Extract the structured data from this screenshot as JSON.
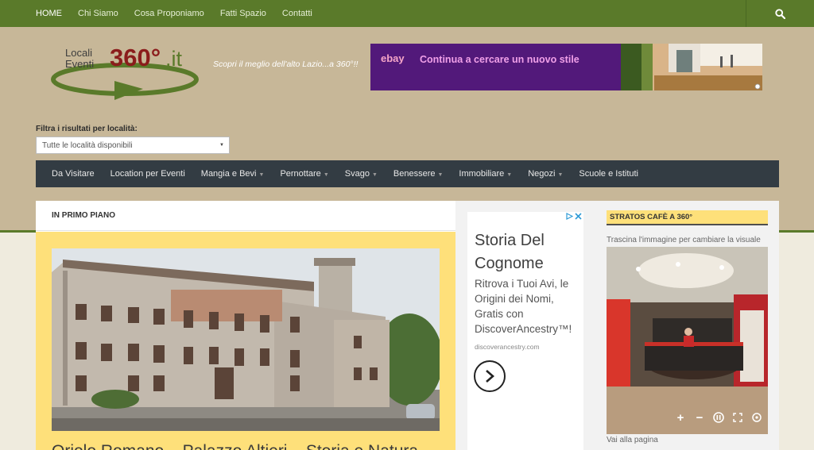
{
  "top_nav": {
    "items": [
      {
        "label": "HOME",
        "active": true
      },
      {
        "label": "Chi Siamo"
      },
      {
        "label": "Cosa Proponiamo"
      },
      {
        "label": "Fatti Spazio"
      },
      {
        "label": "Contatti"
      }
    ],
    "search_icon": "search-icon"
  },
  "header": {
    "logo": {
      "line1": "Locali",
      "line2": "Eventi",
      "brand": "360°",
      "tld": ".it"
    },
    "tagline": "Scopri il meglio dell'alto Lazio...a 360°!!"
  },
  "ad_banner": {
    "advertiser": "ebay",
    "text": "Continua a cercare un nuovo stile"
  },
  "filter": {
    "label": "Filtra i risultati per località:",
    "selected": "Tutte le località disponibili"
  },
  "main_nav": {
    "items": [
      {
        "label": "Da Visitare",
        "has_dropdown": false
      },
      {
        "label": "Location per Eventi",
        "has_dropdown": false
      },
      {
        "label": "Mangia e Bevi",
        "has_dropdown": true
      },
      {
        "label": "Pernottare",
        "has_dropdown": true
      },
      {
        "label": "Svago",
        "has_dropdown": true
      },
      {
        "label": "Benessere",
        "has_dropdown": true
      },
      {
        "label": "Immobiliare",
        "has_dropdown": true
      },
      {
        "label": "Negozi",
        "has_dropdown": true
      },
      {
        "label": "Scuole e Istituti",
        "has_dropdown": false
      }
    ]
  },
  "featured": {
    "section_title": "IN PRIMO PIANO",
    "article_title": "Oriolo Romano – Palazzo Altieri – Storia e Natura"
  },
  "side_ad": {
    "title": "Storia Del Cognome",
    "body": "Ritrova i Tuoi Avi, le Origini dei Nomi, Gratis con DiscoverAncestry™!",
    "url": "discoverancestry.com"
  },
  "sidebar": {
    "widget_title": "STRATOS CAFÈ A 360°",
    "hint": "Trascina l'immagine per cambiare la visuale",
    "link": "Vai alla pagina"
  },
  "colors": {
    "topbar": "#5a7a2a",
    "header_bg": "#c7b798",
    "main_nav_bg": "#333c43",
    "accent_yellow": "#fee07a",
    "logo_red": "#8b1c1c"
  }
}
